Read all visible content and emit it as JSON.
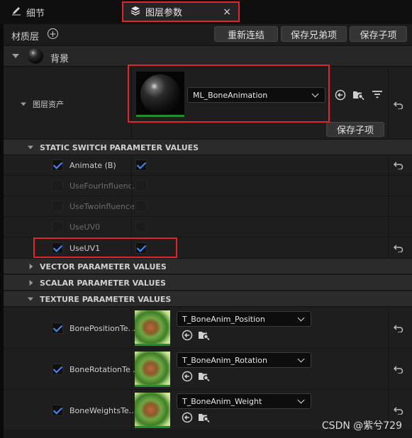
{
  "tabs": [
    {
      "label": "细节"
    },
    {
      "label": "图层参数",
      "close": "×"
    }
  ],
  "toolbar": {
    "label": "材质层",
    "add": "+",
    "buttons": [
      "重新连结",
      "保存兄弟项",
      "保存子项"
    ]
  },
  "layer": {
    "name": "背景",
    "asset_label": "图层资产",
    "asset_value": "ML_BoneAnimation",
    "save_child": "保存子项"
  },
  "sections": {
    "static_switch": "STATIC SWITCH PARAMETER VALUES",
    "vector": "VECTOR PARAMETER VALUES",
    "scalar": "SCALAR PARAMETER VALUES",
    "texture": "TEXTURE PARAMETER VALUES"
  },
  "switch_params": [
    {
      "name": "Animate (B)",
      "override": true,
      "value": true,
      "enabled": true
    },
    {
      "name": "UseFourInfluenc...",
      "override": false,
      "value": false,
      "enabled": false
    },
    {
      "name": "UseTwoInfluence...",
      "override": false,
      "value": false,
      "enabled": false
    },
    {
      "name": "UseUV0",
      "override": false,
      "value": false,
      "enabled": false
    },
    {
      "name": "UseUV1",
      "override": true,
      "value": true,
      "enabled": true
    }
  ],
  "texture_params": [
    {
      "name": "BonePositionTe...",
      "texture": "T_BoneAnim_Position"
    },
    {
      "name": "BoneRotationTe...",
      "texture": "T_BoneAnim_Rotation"
    },
    {
      "name": "BoneWeightsTe...",
      "texture": "T_BoneAnim_Weight"
    }
  ],
  "watermark": "CSDN @紫兮729",
  "colors": {
    "accent": "#3d8bff",
    "highlight": "#e0262a"
  }
}
